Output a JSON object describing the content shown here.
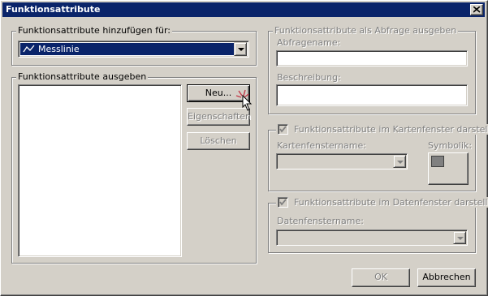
{
  "window": {
    "title": "Funktionsattribute"
  },
  "add_group": {
    "legend": "Funktionsattribute hinzufügen für:",
    "selected_value": "Messlinie",
    "icon": "polyline-icon"
  },
  "output_group": {
    "legend": "Funktionsattribute ausgeben",
    "new_label": "Neu...",
    "properties_label": "Eigenschaften",
    "delete_label": "Löschen"
  },
  "query_group": {
    "legend": "Funktionsattribute als Abfrage ausgeben",
    "query_name_label": "Abfragename:",
    "query_name_value": "",
    "description_label": "Beschreibung:",
    "description_value": ""
  },
  "map_group": {
    "legend": "Funktionsattribute im Kartenfenster darstellen",
    "checked": true,
    "window_name_label": "Kartenfenstername:",
    "window_name_value": "",
    "symbol_label": "Symbolik:"
  },
  "data_group": {
    "legend": "Funktionsattribute im Datenfenster darstellen",
    "checked": true,
    "window_name_label": "Datenfenstername:",
    "window_name_value": ""
  },
  "footer": {
    "ok_label": "OK",
    "cancel_label": "Abbrechen"
  },
  "colors": {
    "titlebar": "#0a246a",
    "dialog_face": "#d4d0c8",
    "selection": "#0a246a"
  }
}
